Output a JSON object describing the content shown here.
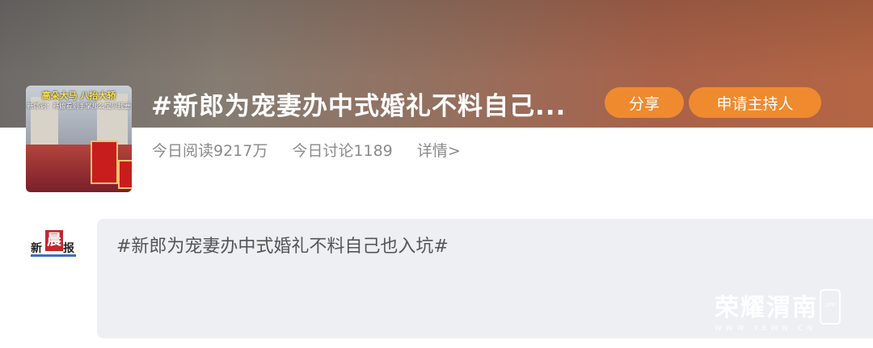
{
  "topic": {
    "title": "#新郎为宠妻办中式婚礼不料自己...",
    "thumbnail": {
      "caption_line1": "高朵大马 八抬大轿",
      "caption_line2": "新郎说：新娘看到手掌那么宝贝我要"
    },
    "buttons": {
      "share": "分享",
      "apply_host": "申请主持人"
    },
    "stats": {
      "reads": "今日阅读9217万",
      "discussions": "今日讨论1189",
      "details": "详情>"
    }
  },
  "post": {
    "logo": {
      "left": "新",
      "mid": "晨",
      "right": "报"
    },
    "text": "#新郎为宠妻办中式婚礼不料自己也入坑#"
  },
  "watermark": {
    "name": "荣耀渭南",
    "url": "WWW.YEWN.CN",
    "badge": "APP"
  },
  "colors": {
    "accent": "#ef8a2f",
    "post_bg": "#eeeff3",
    "stat_text": "#8a8a8a"
  }
}
